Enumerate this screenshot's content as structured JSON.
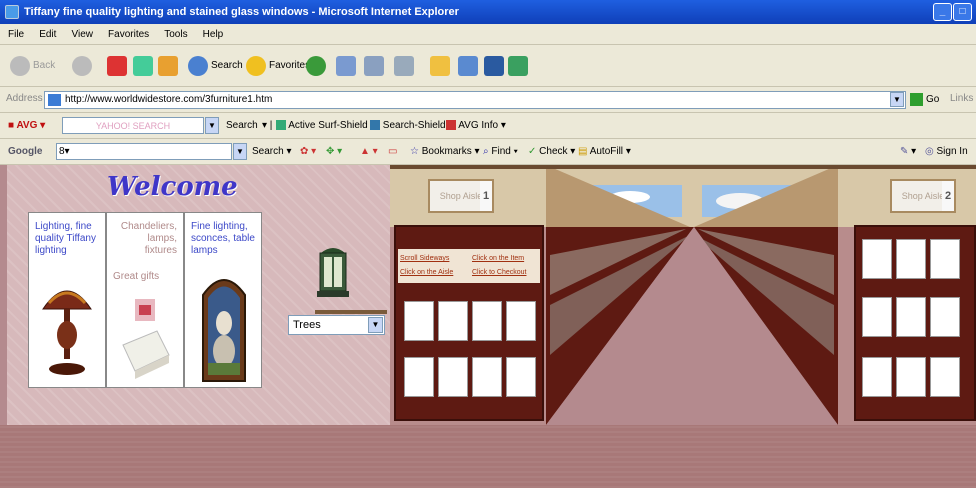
{
  "window": {
    "title": "Tiffany fine quality lighting and stained glass windows - Microsoft Internet Explorer"
  },
  "menu": [
    "File",
    "Edit",
    "View",
    "Favorites",
    "Tools",
    "Help"
  ],
  "toolbar": {
    "back": "Back",
    "search": "Search",
    "favorites": "Favorites"
  },
  "address": {
    "label": "Address",
    "url": "http://www.worldwidestore.com/3furniture1.htm",
    "go": "Go",
    "links": "Links"
  },
  "avg": {
    "label": "AVG",
    "search_placeholder": "YAHOO! SEARCH",
    "search": "Search",
    "active_surf": "Active Surf-Shield",
    "search_shield": "Search-Shield",
    "info": "AVG Info"
  },
  "google": {
    "label": "Google",
    "search": "Search",
    "bookmarks": "Bookmarks",
    "find": "Find",
    "check": "Check",
    "autofill": "AutoFill",
    "signin": "Sign In"
  },
  "page": {
    "welcome": "Welcome",
    "cards": [
      {
        "text": "Lighting, fine quality Tiffany lighting"
      },
      {
        "text": "Chandeliers, lamps, fixtures",
        "sub": "Great gifts"
      },
      {
        "text": "Fine lighting, sconces, table lamps"
      }
    ],
    "select_value": "Trees",
    "mall": {
      "sign_left": "Shop Aisle",
      "sign_left_num": "1",
      "sign_right": "Shop Aisle",
      "sign_right_num": "2",
      "links": [
        "Scroll Sideways",
        "Click on the Item",
        "Click on the Aisle",
        "Click to Checkout"
      ]
    }
  }
}
